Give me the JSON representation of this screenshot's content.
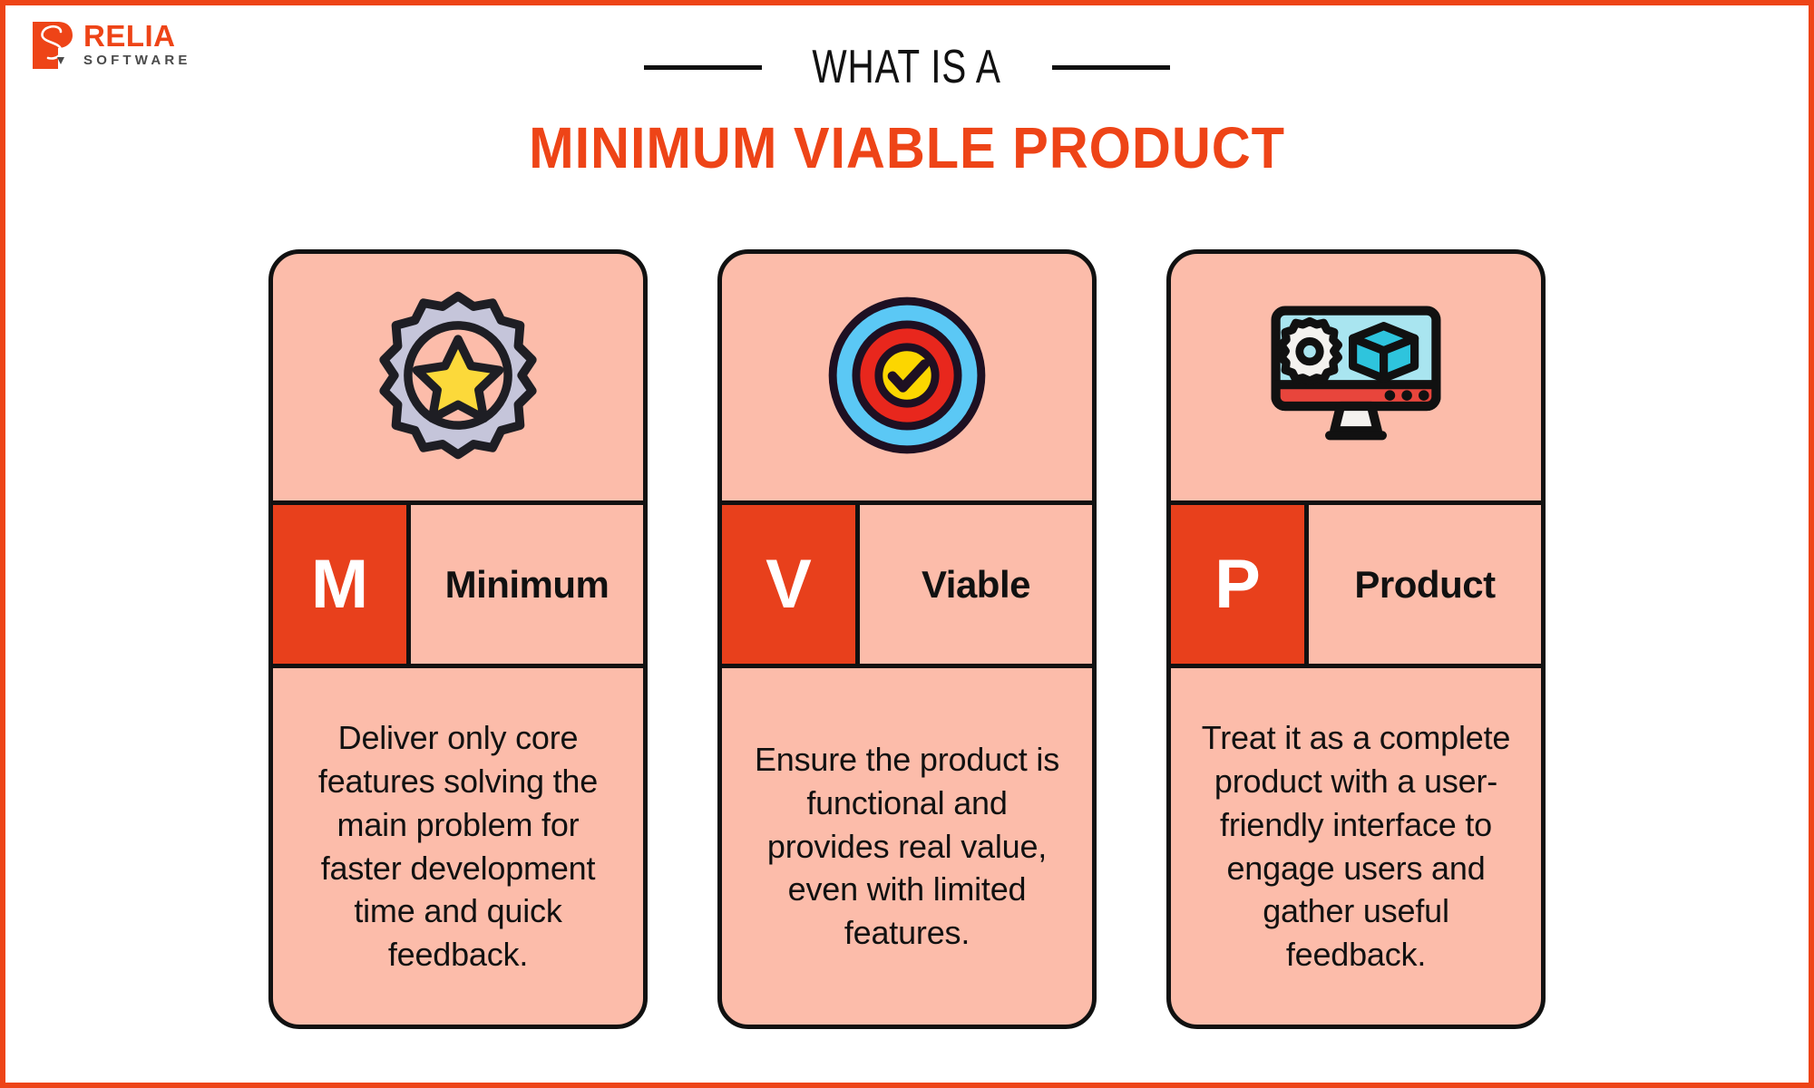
{
  "brand": {
    "name": "RELIA",
    "tagline": "SOFTWARE",
    "logo_icon": "relia-r-mark",
    "accent_color": "#ee4417"
  },
  "header": {
    "eyebrow": "WHAT IS A",
    "headline": "MINIMUM VIABLE PRODUCT",
    "headline_color": "#ee4417",
    "eyebrow_color": "#111111"
  },
  "theme": {
    "frame_color": "#ee4417",
    "card_background": "#fcbcaa",
    "card_border": "#111111",
    "letter_badge_background": "#e8401c",
    "letter_badge_text": "#ffffff",
    "page_background": "#ffffff"
  },
  "cards": [
    {
      "letter": "M",
      "word": "Minimum",
      "icon": "gear-with-star-icon",
      "icon_colors": {
        "gear": "#c5c5da",
        "star": "#fcd93a",
        "outline": "#1e1e24"
      },
      "body": "Deliver only core features solving the main problem for faster development time and quick feedback."
    },
    {
      "letter": "V",
      "word": "Viable",
      "icon": "bullseye-target-check-icon",
      "icon_colors": {
        "outer_ring": "#5bc8f5",
        "middle_ring": "#e8271d",
        "center": "#fcd600",
        "outline": "#1e1022"
      },
      "body": "Ensure the product is functional and provides real value, even with limited features."
    },
    {
      "letter": "P",
      "word": "Product",
      "icon": "monitor-with-gear-and-cube-icon",
      "icon_colors": {
        "screen": "#a9e5f0",
        "cube": "#2ec4dd",
        "base": "#e8453c",
        "gear": "#f4f2ef",
        "outline": "#111111"
      },
      "body": "Treat it as a complete product with a user-friendly interface to engage users and gather useful feedback."
    }
  ]
}
